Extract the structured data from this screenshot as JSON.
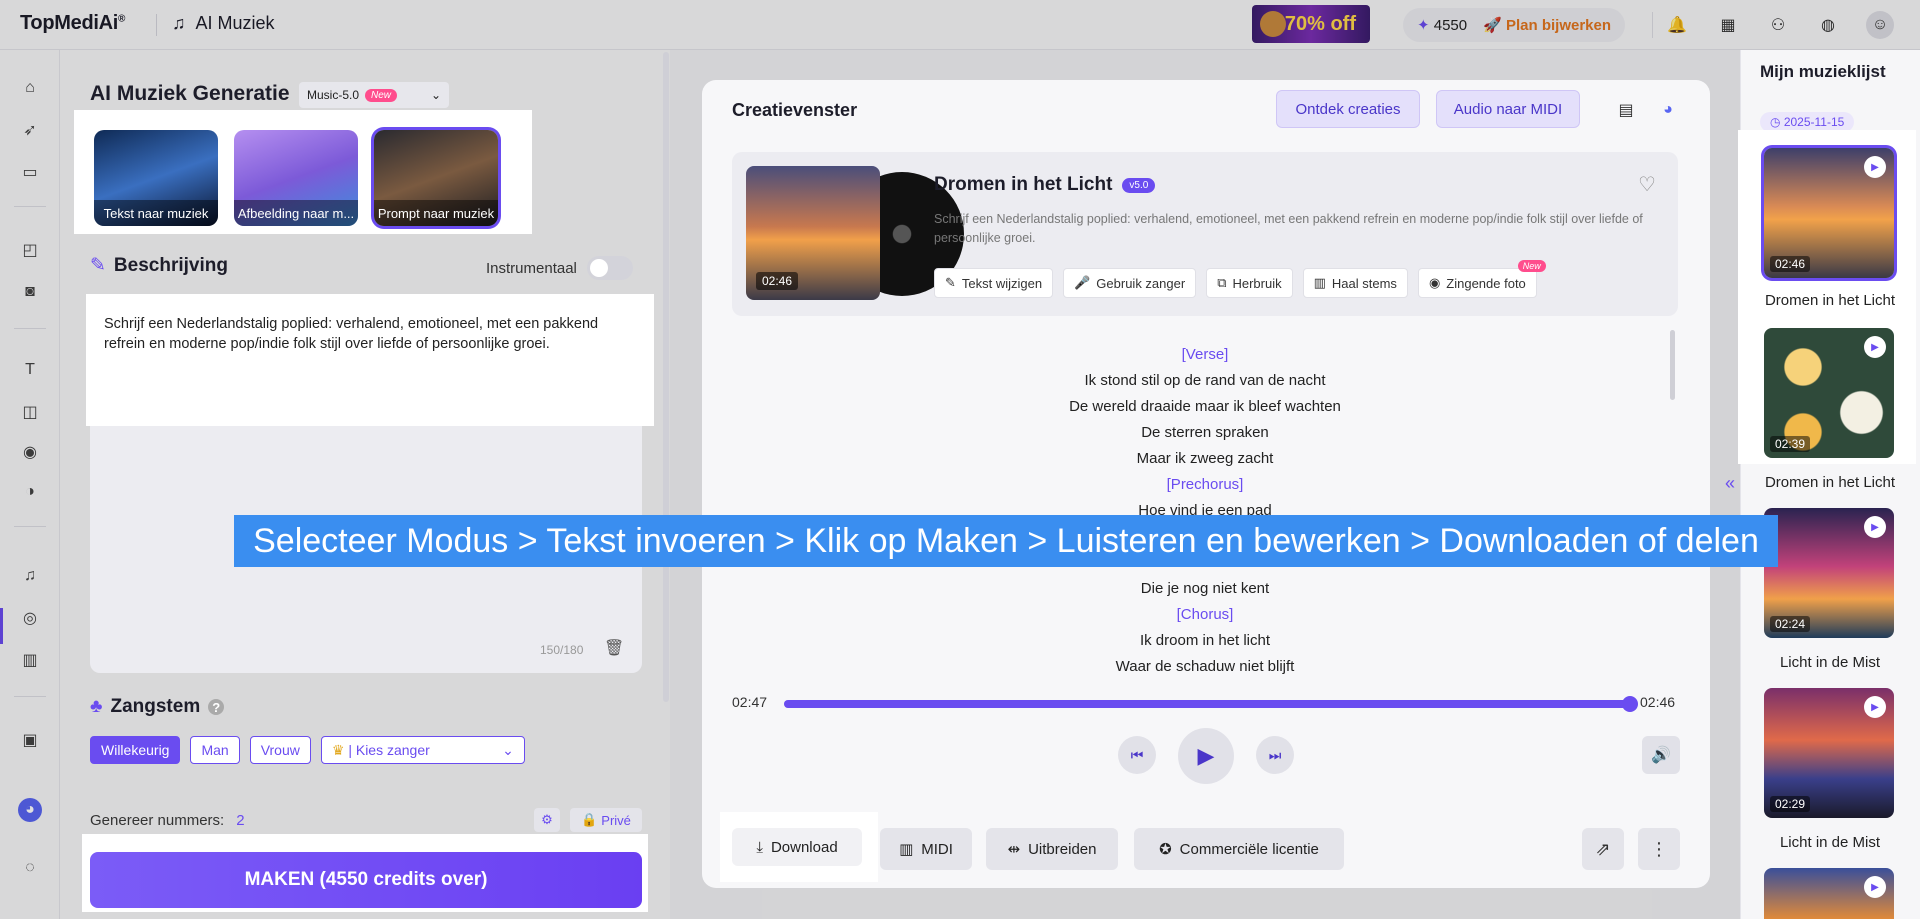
{
  "header": {
    "logo": "TopMediAi",
    "logo_mark": "®",
    "app_title": "AI Muziek",
    "promo": "70% off",
    "credits": "4550",
    "plan_label": "Plan bijwerken"
  },
  "panel": {
    "title": "AI Muziek Generatie",
    "model": "Music-5.0",
    "model_badge": "New",
    "modes": [
      {
        "label": "Tekst naar muziek"
      },
      {
        "label": "Afbeelding naar m..."
      },
      {
        "label": "Prompt naar muziek"
      }
    ],
    "description_title": "Beschrijving",
    "instrumental_label": "Instrumentaal",
    "description_text": "Schrijf een Nederlandstalig poplied: verhalend, emotioneel, met een pakkend refrein en moderne pop/indie folk stijl over liefde of persoonlijke groei.",
    "counter": "150/180",
    "voice_title": "Zangstem",
    "voice_options": [
      "Willekeurig",
      "Man",
      "Vrouw"
    ],
    "singer_select": "Kies zanger",
    "generate_label": "Genereer nummers:",
    "generate_count": "2",
    "privacy_label": "Privé",
    "make_button": "MAKEN (4550 credits over)"
  },
  "main": {
    "title": "Creatievenster",
    "discover_button": "Ontdek creaties",
    "midi_button": "Audio naar MIDI",
    "song": {
      "title": "Dromen in het Licht",
      "version": "v5.0",
      "duration": "02:46",
      "description": "Schrijf een Nederlandstalig poplied: verhalend, emotioneel, met een pakkend refrein en moderne pop/indie folk stijl over liefde of persoonlijke groei.",
      "actions": [
        "Tekst wijzigen",
        "Gebruik zanger",
        "Herbruik",
        "Haal stems",
        "Zingende foto"
      ],
      "new_badge": "New"
    },
    "lyrics": [
      {
        "text": "[Verse]",
        "tag": true
      },
      {
        "text": "Ik stond stil op de rand van de nacht",
        "tag": false
      },
      {
        "text": "De wereld draaide maar ik bleef wachten",
        "tag": false
      },
      {
        "text": "De sterren spraken",
        "tag": false
      },
      {
        "text": "Maar ik zweeg zacht",
        "tag": false
      },
      {
        "text": "[Prechorus]",
        "tag": true
      },
      {
        "text": "Hoe vind je een pad",
        "tag": false
      },
      {
        "text": "",
        "tag": false
      },
      {
        "text": "",
        "tag": false
      },
      {
        "text": "Die je nog niet kent",
        "tag": false
      },
      {
        "text": "[Chorus]",
        "tag": true
      },
      {
        "text": "Ik droom in het licht",
        "tag": false
      },
      {
        "text": "Waar de schaduw niet blijft",
        "tag": false
      }
    ],
    "time_current": "02:47",
    "time_total": "02:46",
    "progress": 1.0,
    "download_button": "Download",
    "midi_btn": "MIDI",
    "extend_button": "Uitbreiden",
    "license_button": "Commerciële licentie"
  },
  "right": {
    "title": "Mijn muzieklijst",
    "date": "2025-11-15",
    "items": [
      {
        "time": "02:46",
        "name": "Dromen in het Licht"
      },
      {
        "time": "02:39",
        "name": "Dromen in het Licht"
      },
      {
        "time": "02:24",
        "name": "Licht in de Mist"
      },
      {
        "time": "02:29",
        "name": "Licht in de Mist"
      },
      {
        "time": "",
        "name": ""
      }
    ]
  },
  "caption": "Selecteer Modus > Tekst invoeren > Klik op Maken > Luisteren en bewerken > Downloaden of delen"
}
